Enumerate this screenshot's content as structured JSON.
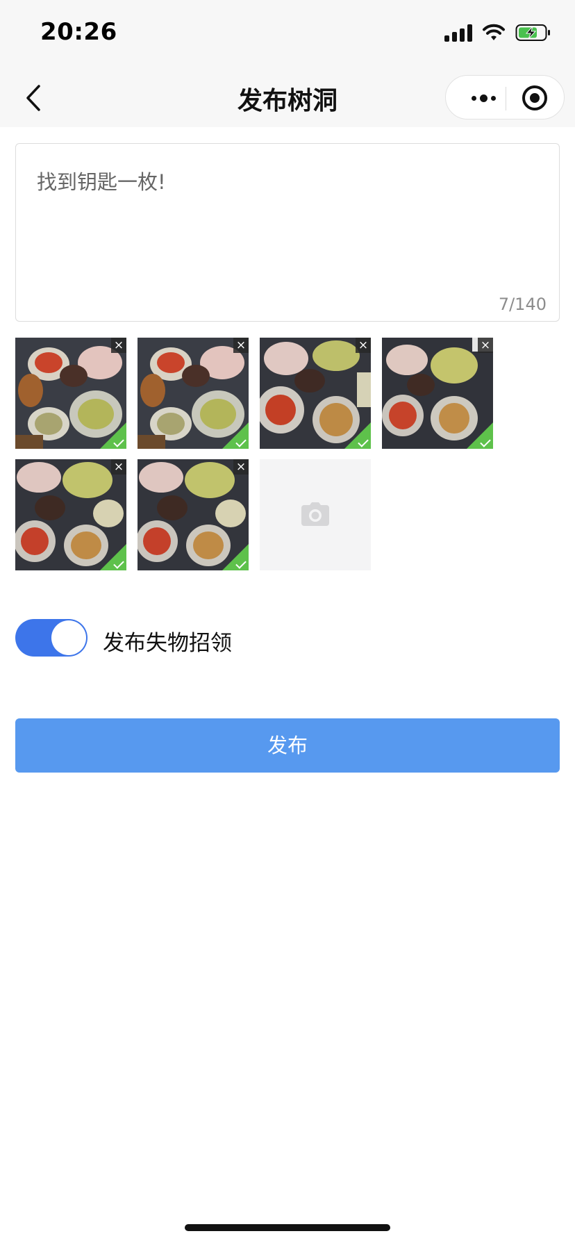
{
  "status_bar": {
    "time": "20:26",
    "icons": [
      "signal-icon",
      "wifi-icon",
      "battery-charging-icon"
    ]
  },
  "nav": {
    "back_icon": "chevron-left-icon",
    "title": "发布树洞",
    "capsule_icons": [
      "more-dots-icon",
      "target-icon"
    ]
  },
  "editor": {
    "content": "找到钥匙一枚!",
    "counter": "7/140"
  },
  "photos": {
    "uploaded_count": 6,
    "status_icon": "uploaded-check-icon",
    "remove_label": "×",
    "add_icon": "camera-icon"
  },
  "lost_found": {
    "label": "发布失物招领",
    "enabled": true
  },
  "submit": {
    "label": "发布"
  },
  "colors": {
    "accent": "#3d75ea",
    "button": "#5799ef",
    "success": "#5ec14b"
  }
}
